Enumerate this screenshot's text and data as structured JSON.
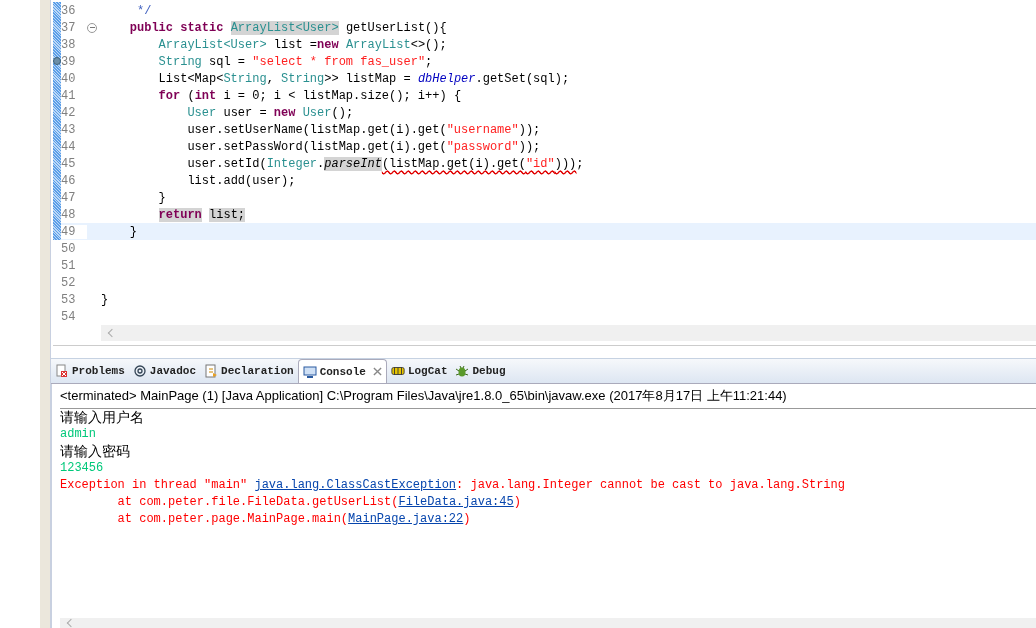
{
  "editor": {
    "lines": [
      {
        "num": "36",
        "changed": true,
        "fold": false,
        "breakpoint": false,
        "current": false,
        "tokens": [
          {
            "t": "     */",
            "kind": "comment",
            "highlighted": false,
            "error_underline": false
          }
        ]
      },
      {
        "num": "37",
        "changed": true,
        "fold": true,
        "breakpoint": false,
        "current": false,
        "tokens": [
          {
            "t": "    public static ",
            "kind": "keyword",
            "highlighted": false,
            "error_underline": false
          },
          {
            "t": "ArrayList<User>",
            "kind": "type",
            "highlighted": true,
            "error_underline": false
          },
          {
            "t": " getUserList(){",
            "kind": "plain",
            "highlighted": false,
            "error_underline": false
          }
        ]
      },
      {
        "num": "38",
        "changed": true,
        "fold": false,
        "breakpoint": false,
        "current": false,
        "tokens": [
          {
            "t": "        ArrayList<User>",
            "kind": "type",
            "highlighted": false,
            "error_underline": false
          },
          {
            "t": " list =",
            "kind": "plain",
            "highlighted": false,
            "error_underline": false
          },
          {
            "t": "new ",
            "kind": "keyword",
            "highlighted": false,
            "error_underline": false
          },
          {
            "t": "ArrayList",
            "kind": "type",
            "highlighted": false,
            "error_underline": false
          },
          {
            "t": "<>();",
            "kind": "plain",
            "highlighted": false,
            "error_underline": false
          }
        ]
      },
      {
        "num": "39",
        "changed": true,
        "fold": false,
        "breakpoint": true,
        "current": false,
        "tokens": [
          {
            "t": "        String",
            "kind": "type",
            "highlighted": false,
            "error_underline": false
          },
          {
            "t": " sql = ",
            "kind": "plain",
            "highlighted": false,
            "error_underline": false
          },
          {
            "t": "\"select * from fas_user\"",
            "kind": "string",
            "highlighted": false,
            "error_underline": false
          },
          {
            "t": ";",
            "kind": "plain",
            "highlighted": false,
            "error_underline": false
          }
        ]
      },
      {
        "num": "40",
        "changed": true,
        "fold": false,
        "breakpoint": false,
        "current": false,
        "tokens": [
          {
            "t": "        List<Map<",
            "kind": "plain",
            "highlighted": false,
            "error_underline": false
          },
          {
            "t": "String",
            "kind": "type",
            "highlighted": false,
            "error_underline": false
          },
          {
            "t": ", ",
            "kind": "plain",
            "highlighted": false,
            "error_underline": false
          },
          {
            "t": "String",
            "kind": "type",
            "highlighted": false,
            "error_underline": false
          },
          {
            "t": ">> listMap = ",
            "kind": "plain",
            "highlighted": false,
            "error_underline": false
          },
          {
            "t": "dbHelper",
            "kind": "field",
            "highlighted": false,
            "error_underline": false
          },
          {
            "t": ".getSet(sql);",
            "kind": "plain",
            "highlighted": false,
            "error_underline": false
          }
        ]
      },
      {
        "num": "41",
        "changed": true,
        "fold": false,
        "breakpoint": false,
        "current": false,
        "tokens": [
          {
            "t": "        for",
            "kind": "keyword",
            "highlighted": false,
            "error_underline": false
          },
          {
            "t": " (",
            "kind": "plain",
            "highlighted": false,
            "error_underline": false
          },
          {
            "t": "int",
            "kind": "keyword",
            "highlighted": false,
            "error_underline": false
          },
          {
            "t": " i = 0; i < listMap.size(); i++) {",
            "kind": "plain",
            "highlighted": false,
            "error_underline": false
          }
        ]
      },
      {
        "num": "42",
        "changed": true,
        "fold": false,
        "breakpoint": false,
        "current": false,
        "tokens": [
          {
            "t": "            User",
            "kind": "type",
            "highlighted": false,
            "error_underline": false
          },
          {
            "t": " user = ",
            "kind": "plain",
            "highlighted": false,
            "error_underline": false
          },
          {
            "t": "new ",
            "kind": "keyword",
            "highlighted": false,
            "error_underline": false
          },
          {
            "t": "User",
            "kind": "type",
            "highlighted": false,
            "error_underline": false
          },
          {
            "t": "();",
            "kind": "plain",
            "highlighted": false,
            "error_underline": false
          }
        ]
      },
      {
        "num": "43",
        "changed": true,
        "fold": false,
        "breakpoint": false,
        "current": false,
        "tokens": [
          {
            "t": "            user.setUserName(listMap.get(i).get(",
            "kind": "plain",
            "highlighted": false,
            "error_underline": false
          },
          {
            "t": "\"username\"",
            "kind": "string",
            "highlighted": false,
            "error_underline": false
          },
          {
            "t": "));",
            "kind": "plain",
            "highlighted": false,
            "error_underline": false
          }
        ]
      },
      {
        "num": "44",
        "changed": true,
        "fold": false,
        "breakpoint": false,
        "current": false,
        "tokens": [
          {
            "t": "            user.setPassWord(listMap.get(i).get(",
            "kind": "plain",
            "highlighted": false,
            "error_underline": false
          },
          {
            "t": "\"password\"",
            "kind": "string",
            "highlighted": false,
            "error_underline": false
          },
          {
            "t": "));",
            "kind": "plain",
            "highlighted": false,
            "error_underline": false
          }
        ]
      },
      {
        "num": "45",
        "changed": true,
        "fold": false,
        "breakpoint": false,
        "current": false,
        "tokens": [
          {
            "t": "            user.setId(",
            "kind": "plain",
            "highlighted": false,
            "error_underline": false
          },
          {
            "t": "Integer",
            "kind": "type",
            "highlighted": false,
            "error_underline": false
          },
          {
            "t": ".",
            "kind": "plain",
            "highlighted": false,
            "error_underline": false
          },
          {
            "t": "parseInt",
            "kind": "static",
            "highlighted": true,
            "error_underline": false
          },
          {
            "t": "(listMap.get(i).get(",
            "kind": "plain",
            "highlighted": false,
            "error_underline": true
          },
          {
            "t": "\"id\"",
            "kind": "string",
            "highlighted": false,
            "error_underline": true
          },
          {
            "t": ")))",
            "kind": "plain",
            "highlighted": false,
            "error_underline": true
          },
          {
            "t": ";",
            "kind": "plain",
            "highlighted": false,
            "error_underline": false
          }
        ]
      },
      {
        "num": "46",
        "changed": true,
        "fold": false,
        "breakpoint": false,
        "current": false,
        "tokens": [
          {
            "t": "            list.add(user);",
            "kind": "plain",
            "highlighted": false,
            "error_underline": false
          }
        ]
      },
      {
        "num": "47",
        "changed": true,
        "fold": false,
        "breakpoint": false,
        "current": false,
        "tokens": [
          {
            "t": "        }",
            "kind": "plain",
            "highlighted": false,
            "error_underline": false
          }
        ]
      },
      {
        "num": "48",
        "changed": true,
        "fold": false,
        "breakpoint": false,
        "current": false,
        "tokens": [
          {
            "t": "        return",
            "kind": "keyword",
            "highlighted": true,
            "error_underline": false
          },
          {
            "t": " list;",
            "kind": "plain",
            "highlighted": true,
            "error_underline": false
          }
        ]
      },
      {
        "num": "49",
        "changed": true,
        "fold": false,
        "breakpoint": false,
        "current": true,
        "tokens": [
          {
            "t": "    }",
            "kind": "plain",
            "highlighted": false,
            "error_underline": false
          }
        ]
      },
      {
        "num": "50",
        "changed": false,
        "fold": false,
        "breakpoint": false,
        "current": false
      },
      {
        "num": "51",
        "changed": false,
        "fold": false,
        "breakpoint": false,
        "current": false
      },
      {
        "num": "52",
        "changed": false,
        "fold": false,
        "breakpoint": false,
        "current": false
      },
      {
        "num": "53",
        "changed": false,
        "fold": false,
        "breakpoint": false,
        "current": false,
        "tokens": [
          {
            "t": "}",
            "kind": "plain",
            "highlighted": false,
            "error_underline": false
          }
        ]
      },
      {
        "num": "54",
        "changed": false,
        "fold": false,
        "breakpoint": false,
        "current": false
      }
    ]
  },
  "tabs": [
    {
      "label": "Problems",
      "kind": "problems",
      "selected": false,
      "closable": false
    },
    {
      "label": "Javadoc",
      "kind": "javadoc",
      "selected": false,
      "closable": false
    },
    {
      "label": "Declaration",
      "kind": "declaration",
      "selected": false,
      "closable": false
    },
    {
      "label": "Console",
      "kind": "console",
      "selected": true,
      "closable": true
    },
    {
      "label": "LogCat",
      "kind": "logcat",
      "selected": false,
      "closable": false
    },
    {
      "label": "Debug",
      "kind": "debug",
      "selected": false,
      "closable": false
    }
  ],
  "console": {
    "header": "<terminated> MainPage (1) [Java Application] C:\\Program Files\\Java\\jre1.8.0_65\\bin\\javaw.exe (2017年8月17日 上午11:21:44)",
    "lines": [
      {
        "kind": "prompt",
        "parts": [
          {
            "t": "请输入用户名",
            "link": false
          }
        ]
      },
      {
        "kind": "input",
        "parts": [
          {
            "t": "admin",
            "link": false
          }
        ]
      },
      {
        "kind": "prompt",
        "parts": [
          {
            "t": "请输入密码",
            "link": false
          }
        ]
      },
      {
        "kind": "input",
        "parts": [
          {
            "t": "123456",
            "link": false
          }
        ]
      },
      {
        "kind": "error",
        "parts": [
          {
            "t": "Exception in thread \"main\" ",
            "link": false
          },
          {
            "t": "java.lang.ClassCastException",
            "link": true
          },
          {
            "t": ": java.lang.Integer cannot be cast to java.lang.String",
            "link": false
          }
        ]
      },
      {
        "kind": "error",
        "parts": [
          {
            "t": "        at com.peter.file.FileData.getUserList(",
            "link": false
          },
          {
            "t": "FileData.java:45",
            "link": true
          },
          {
            "t": ")",
            "link": false
          }
        ]
      },
      {
        "kind": "error",
        "parts": [
          {
            "t": "        at com.peter.page.MainPage.main(",
            "link": false
          },
          {
            "t": "MainPage.java:22",
            "link": true
          },
          {
            "t": ")",
            "link": false
          }
        ]
      }
    ]
  }
}
